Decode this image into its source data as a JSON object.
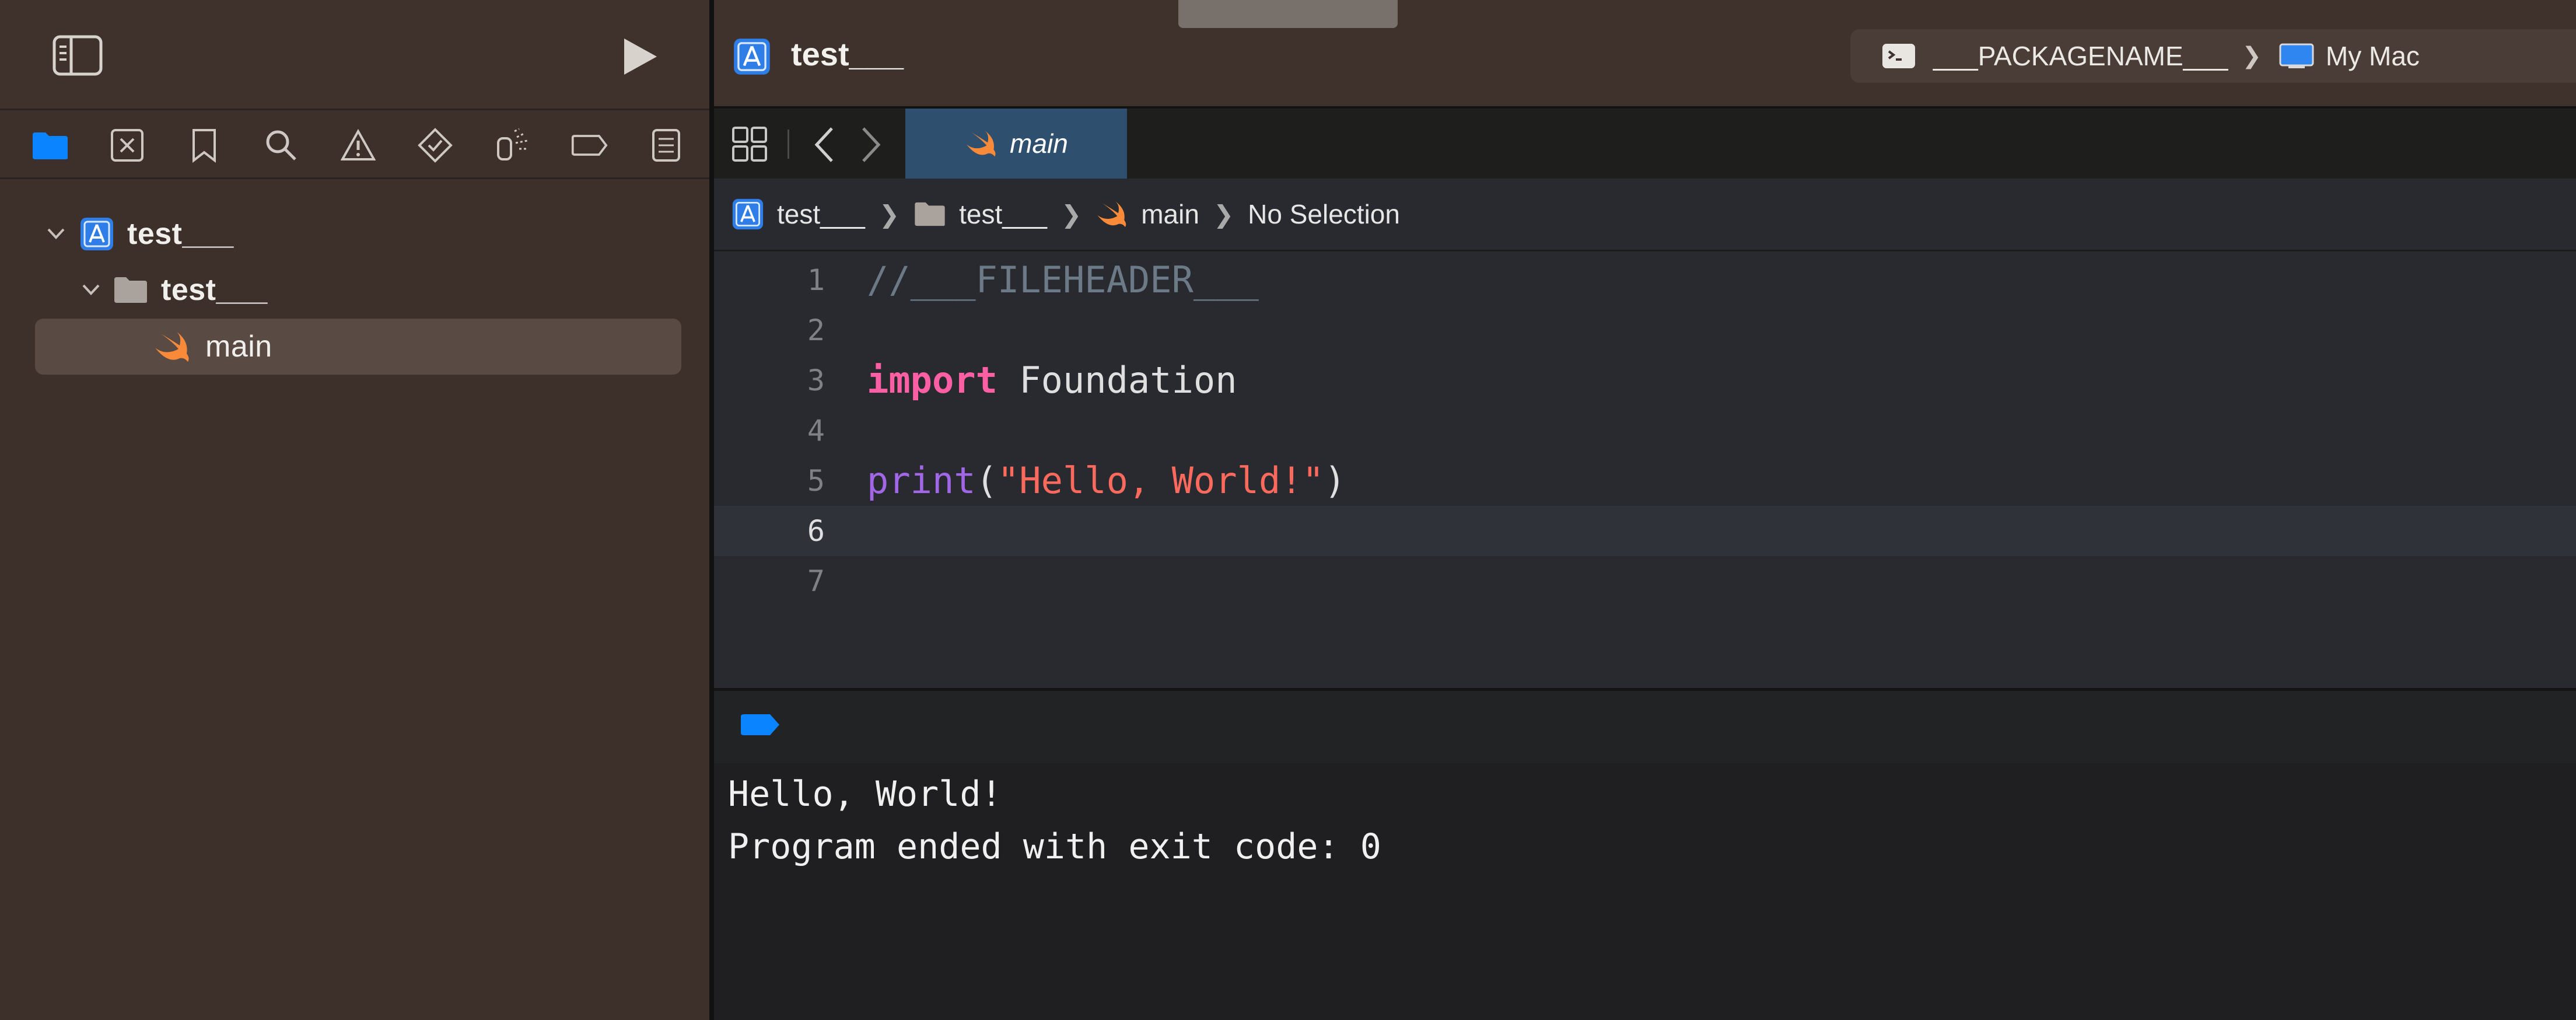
{
  "sidebar": {
    "nav_icons": [
      "folder-icon",
      "source-control-icon",
      "bookmark-icon",
      "search-icon",
      "warning-icon",
      "test-icon",
      "debug-icon",
      "breakpoint-icon",
      "report-icon"
    ],
    "tree": [
      {
        "label": "test___",
        "type": "project",
        "expanded": true
      },
      {
        "label": "test___",
        "type": "folder",
        "expanded": true
      },
      {
        "label": "main",
        "type": "swift-file",
        "selected": true
      }
    ]
  },
  "toolbar": {
    "title": "test___",
    "scheme_name": "___PACKAGENAME___",
    "scheme_separator": "❯",
    "destination": "My Mac"
  },
  "tabs": [
    {
      "label": "main",
      "active": true
    }
  ],
  "jumpbar": {
    "items": [
      "test___",
      "test___",
      "main",
      "No Selection"
    ],
    "separator": "❯"
  },
  "code": {
    "lines": [
      {
        "num": "1",
        "text": "//___FILEHEADER___"
      },
      {
        "num": "2",
        "text": ""
      },
      {
        "num": "3",
        "kw": "import",
        "rest": " Foundation"
      },
      {
        "num": "4",
        "text": ""
      },
      {
        "num": "5",
        "fn": "print",
        "open": "(",
        "str": "\"Hello, World!\"",
        "close": ")"
      },
      {
        "num": "6",
        "text": ""
      },
      {
        "num": "7",
        "text": ""
      }
    ],
    "current_line": "6"
  },
  "console": {
    "lines": [
      "Hello, World!",
      "Program ended with exit code: 0"
    ]
  },
  "colors": {
    "accent": "#0a84ff",
    "keyword": "#fc5fa3",
    "function": "#a167e6",
    "string": "#fc6a5d",
    "comment": "#6c7986",
    "swift_orange": "#f88a3a"
  }
}
